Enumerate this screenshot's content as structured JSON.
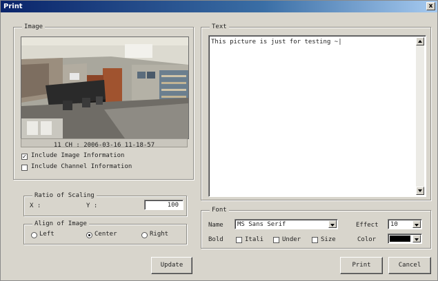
{
  "window": {
    "title": "Print",
    "close_glyph": "x"
  },
  "image_group": {
    "legend": "Image",
    "caption": "11 CH : 2006-03-16 11-18-57",
    "include_image_info": {
      "label": "Include Image Information",
      "checked": true
    },
    "include_channel_info": {
      "label": "Include Channel Information",
      "checked": false
    }
  },
  "scaling": {
    "legend": "Ratio of Scaling",
    "x_label": "X :",
    "y_label": "Y :",
    "value": "100"
  },
  "align": {
    "legend": "Align of Image",
    "options": [
      {
        "label": "Left",
        "selected": false
      },
      {
        "label": "Center",
        "selected": true
      },
      {
        "label": "Right",
        "selected": false
      }
    ]
  },
  "update_button": "Update",
  "text_group": {
    "legend": "Text",
    "content": "This picture is just for testing ~|"
  },
  "font_group": {
    "legend": "Font",
    "name_label": "Name",
    "name_value": "MS Sans Serif",
    "effect_label": "Effect",
    "effect_value": "10",
    "bold_label": "Bold",
    "italic_label": "Itali",
    "under_label": "Under",
    "size_label": "Size",
    "color_label": "Color",
    "color_value": "#000000"
  },
  "print_button": "Print",
  "cancel_button": "Cancel"
}
